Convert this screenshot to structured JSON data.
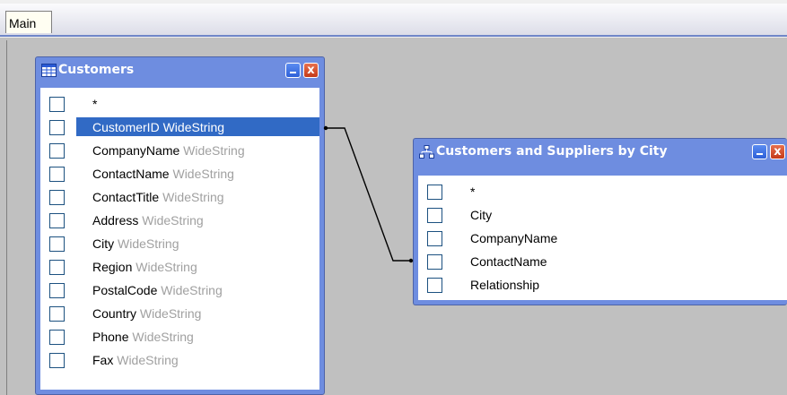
{
  "tabs": [
    {
      "label": "Main"
    }
  ],
  "customers_table": {
    "title": "Customers",
    "icon": "grid-table-icon",
    "fields": [
      {
        "name": "*",
        "type": ""
      },
      {
        "name": "CustomerID",
        "type": "WideString",
        "selected": true
      },
      {
        "name": "CompanyName",
        "type": "WideString"
      },
      {
        "name": "ContactName",
        "type": "WideString"
      },
      {
        "name": "ContactTitle",
        "type": "WideString"
      },
      {
        "name": "Address",
        "type": "WideString"
      },
      {
        "name": "City",
        "type": "WideString"
      },
      {
        "name": "Region",
        "type": "WideString"
      },
      {
        "name": "PostalCode",
        "type": "WideString"
      },
      {
        "name": "Country",
        "type": "WideString"
      },
      {
        "name": "Phone",
        "type": "WideString"
      },
      {
        "name": "Fax",
        "type": "WideString"
      }
    ]
  },
  "suppliers_view": {
    "title": "Customers and Suppliers by City",
    "icon": "hierarchy-view-icon",
    "fields": [
      {
        "name": "*"
      },
      {
        "name": "City"
      },
      {
        "name": "CompanyName"
      },
      {
        "name": "ContactName"
      },
      {
        "name": "Relationship"
      }
    ]
  },
  "window_buttons": {
    "minimize_icon": "minimize-icon",
    "close_label": "x"
  },
  "colors": {
    "titlebar": "#6e8de0",
    "selection": "#316ac5",
    "workspace": "#c0c0c0",
    "type_text": "#a0a0a0"
  }
}
